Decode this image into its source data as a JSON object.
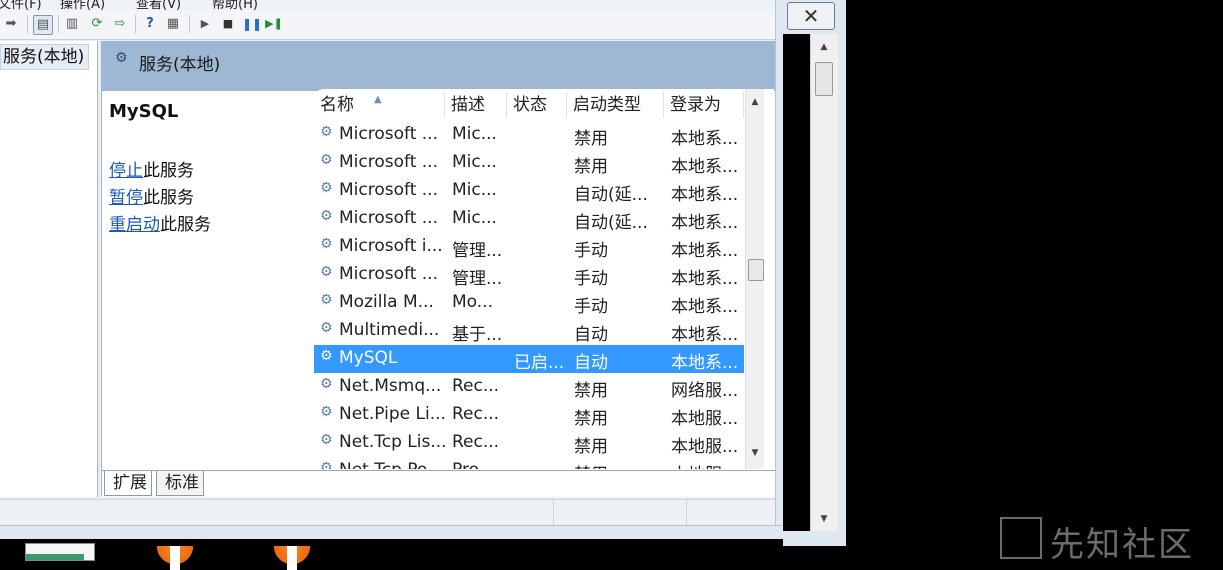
{
  "menu": {
    "items": [
      "文件(F)",
      "操作(A)",
      "查看(V)",
      "帮助(H)"
    ]
  },
  "tree": {
    "root_label": "服务(本地)"
  },
  "header": {
    "title": "服务(本地)"
  },
  "left_panel": {
    "service_name": "MySQL",
    "actions": [
      {
        "link": "停止",
        "suffix": "此服务"
      },
      {
        "link": "暂停",
        "suffix": "此服务"
      },
      {
        "link": "重启动",
        "suffix": "此服务"
      }
    ]
  },
  "table": {
    "columns": [
      "名称",
      "描述",
      "状态",
      "启动类型",
      "登录为"
    ],
    "rows": [
      [
        "Microsoft ...",
        "Mic...",
        "",
        "禁用",
        "本地系..."
      ],
      [
        "Microsoft ...",
        "Mic...",
        "",
        "禁用",
        "本地系..."
      ],
      [
        "Microsoft ...",
        "Mic...",
        "",
        "自动(延...",
        "本地系..."
      ],
      [
        "Microsoft ...",
        "Mic...",
        "",
        "自动(延...",
        "本地系..."
      ],
      [
        "Microsoft i...",
        "管理...",
        "",
        "手动",
        "本地系..."
      ],
      [
        "Microsoft ...",
        "管理...",
        "",
        "手动",
        "本地系..."
      ],
      [
        "Mozilla M...",
        "Mo...",
        "",
        "手动",
        "本地系..."
      ],
      [
        "Multimedi...",
        "基于...",
        "",
        "自动",
        "本地系..."
      ],
      [
        "MySQL",
        "",
        "已启...",
        "自动",
        "本地系..."
      ],
      [
        "Net.Msmq...",
        "Rec...",
        "",
        "禁用",
        "网络服..."
      ],
      [
        "Net.Pipe Li...",
        "Rec...",
        "",
        "禁用",
        "本地服..."
      ],
      [
        "Net.Tcp Lis...",
        "Rec...",
        "",
        "禁用",
        "本地服..."
      ],
      [
        "Net.Tcp Po...",
        "Pro...",
        "",
        "禁用",
        "本地服..."
      ]
    ],
    "selected_row": 8
  },
  "tabs": [
    "扩展",
    "标准"
  ],
  "watermark": "先知社区",
  "colors": {
    "selection": "#3399ff",
    "header_band": "#9eb8d4",
    "link": "#1d58b8"
  }
}
